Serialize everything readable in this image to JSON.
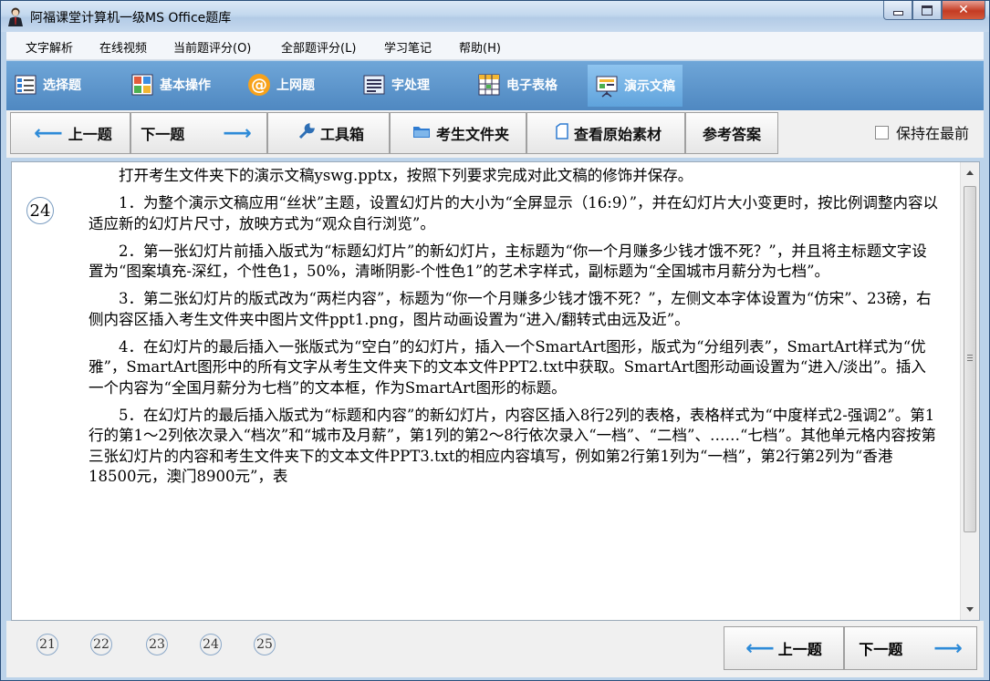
{
  "window": {
    "title": "阿福课堂计算机一级MS Office题库"
  },
  "menu": [
    "文字解析",
    "在线视频",
    "当前题评分(O)",
    "全部题评分(L)",
    "学习笔记",
    "帮助(H)"
  ],
  "tabs": [
    {
      "label": "选择题",
      "icon": "choice-icon"
    },
    {
      "label": "基本操作",
      "icon": "grid-icon"
    },
    {
      "label": "上网题",
      "icon": "at-icon"
    },
    {
      "label": "字处理",
      "icon": "document-icon"
    },
    {
      "label": "电子表格",
      "icon": "spreadsheet-icon"
    },
    {
      "label": "演示文稿",
      "icon": "presentation-icon",
      "active": true
    }
  ],
  "toolbar": {
    "prev": "上一题",
    "next": "下一题",
    "toolbox": "工具箱",
    "folder": "考生文件夹",
    "original": "查看原始素材",
    "answer": "参考答案",
    "keep_on_top": "保持在最前"
  },
  "question": {
    "number": "24",
    "paragraphs": [
      "打开考生文件夹下的演示文稿yswg.pptx，按照下列要求完成对此文稿的修饰并保存。",
      "1．为整个演示文稿应用“丝状”主题，设置幻灯片的大小为“全屏显示（16:9）”，并在幻灯片大小变更时，按比例调整内容以适应新的幻灯片尺寸，放映方式为“观众自行浏览”。",
      "2．第一张幻灯片前插入版式为“标题幻灯片”的新幻灯片，主标题为“你一个月赚多少钱才饿不死？”，并且将主标题文字设置为“图案填充-深红，个性色1，50%，清晰阴影-个性色1”的艺术字样式，副标题为“全国城市月薪分为七档”。",
      "3．第二张幻灯片的版式改为“两栏内容”，标题为“你一个月赚多少钱才饿不死？”，左侧文本字体设置为“仿宋”、23磅，右侧内容区插入考生文件夹中图片文件ppt1.png，图片动画设置为“进入/翻转式由远及近”。",
      "4．在幻灯片的最后插入一张版式为“空白”的幻灯片，插入一个SmartArt图形，版式为“分组列表”，SmartArt样式为“优雅”，SmartArt图形中的所有文字从考生文件夹下的文本文件PPT2.txt中获取。SmartArt图形动画设置为“进入/淡出”。插入一个内容为“全国月薪分为七档”的文本框，作为SmartArt图形的标题。",
      "5．在幻灯片的最后插入版式为“标题和内容”的新幻灯片，内容区插入8行2列的表格，表格样式为“中度样式2-强调2”。第1行的第1～2列依次录入“档次”和“城市及月薪”，第1列的第2～8行依次录入“一档”、“二档”、……“七档”。其他单元格内容按第三张幻灯片的内容和考生文件夹下的文本文件PPT3.txt的相应内容填写，例如第2行第1列为“一档”，第2行第2列为“香港18500元，澳门8900元”，表"
    ]
  },
  "pager": [
    "21",
    "22",
    "23",
    "24",
    "25"
  ],
  "bottom": {
    "prev": "上一题",
    "next": "下一题"
  }
}
